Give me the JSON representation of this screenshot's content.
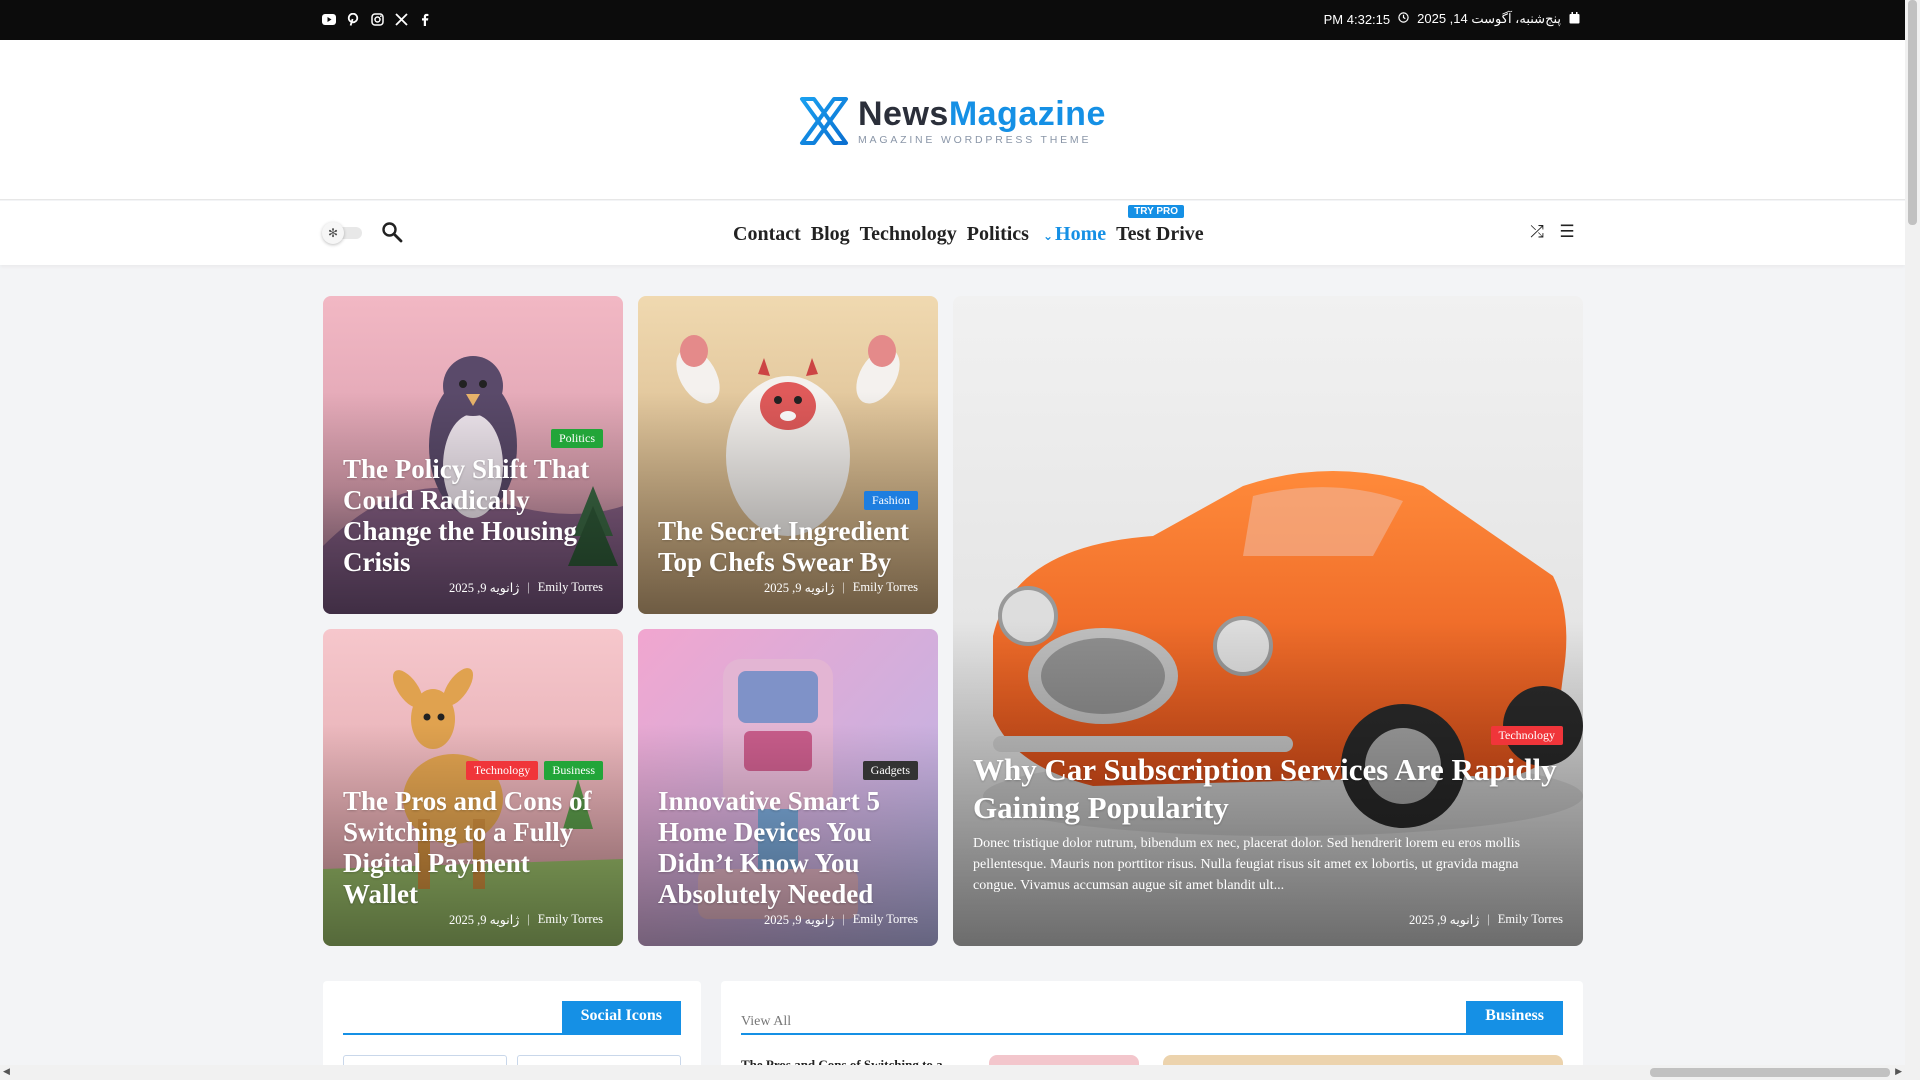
{
  "topbar": {
    "socials": [
      "youtube-icon",
      "pinterest-icon",
      "instagram-icon",
      "x-icon",
      "facebook-icon"
    ],
    "time": "PM 4:32:15",
    "date": "پنج‌شنبه، آگوست 14, 2025"
  },
  "logo": {
    "news": "News",
    "magazine": "Magazine",
    "tagline": "MAGAZINE WORDPRESS THEME"
  },
  "nav": {
    "items": [
      {
        "label": "Contact"
      },
      {
        "label": "Blog"
      },
      {
        "label": "Technology"
      },
      {
        "label": "Politics"
      },
      {
        "label": "Home",
        "active": true
      },
      {
        "label": "Test Drive",
        "badge": "TRY PRO"
      }
    ]
  },
  "colors": {
    "accent": "#1590e5",
    "politics": "#22a539",
    "technology": "#f0353a",
    "fashion": "#1e7ee0",
    "gadgets": "#333333",
    "topbar": "#0c0c0c"
  },
  "posts": [
    {
      "title": "The Policy Shift That Could Radically Change the Housing Crisis",
      "categories": [
        "Politics"
      ],
      "author": "Emily Torres",
      "date": "ژانویه 9, 2025"
    },
    {
      "title": "The Secret Ingredient Top Chefs Swear By",
      "categories": [
        "Fashion"
      ],
      "author": "Emily Torres",
      "date": "ژانویه 9, 2025"
    },
    {
      "title": "Why Car Subscription Services Are Rapidly Gaining Popularity",
      "categories": [
        "Technology"
      ],
      "author": "Emily Torres",
      "date": "ژانویه 9, 2025",
      "excerpt": "Donec tristique dolor rutrum, bibendum ex nec, placerat dolor. Sed hendrerit lorem eu eros mollis pellentesque. Mauris non porttitor risus. Nulla feugiat risus sit amet ex lobortis, ut gravida magna congue. Vivamus accumsan augue sit amet blandit ult..."
    },
    {
      "title": "The Pros and Cons of Switching to a Fully Digital Payment Wallet",
      "categories": [
        "Technology",
        "Business"
      ],
      "author": "Emily Torres",
      "date": "ژانویه 9, 2025"
    },
    {
      "title": "Innovative Smart 5 Home Devices You Didn’t Know You Absolutely Needed",
      "categories": [
        "Gadgets"
      ],
      "author": "Emily Torres",
      "date": "ژانویه 9, 2025"
    }
  ],
  "widgets": {
    "social": {
      "title": "Social Icons"
    },
    "business": {
      "title": "Business",
      "view_all": "View All",
      "first_item": "The Pros and Cons of Switching to a"
    }
  }
}
